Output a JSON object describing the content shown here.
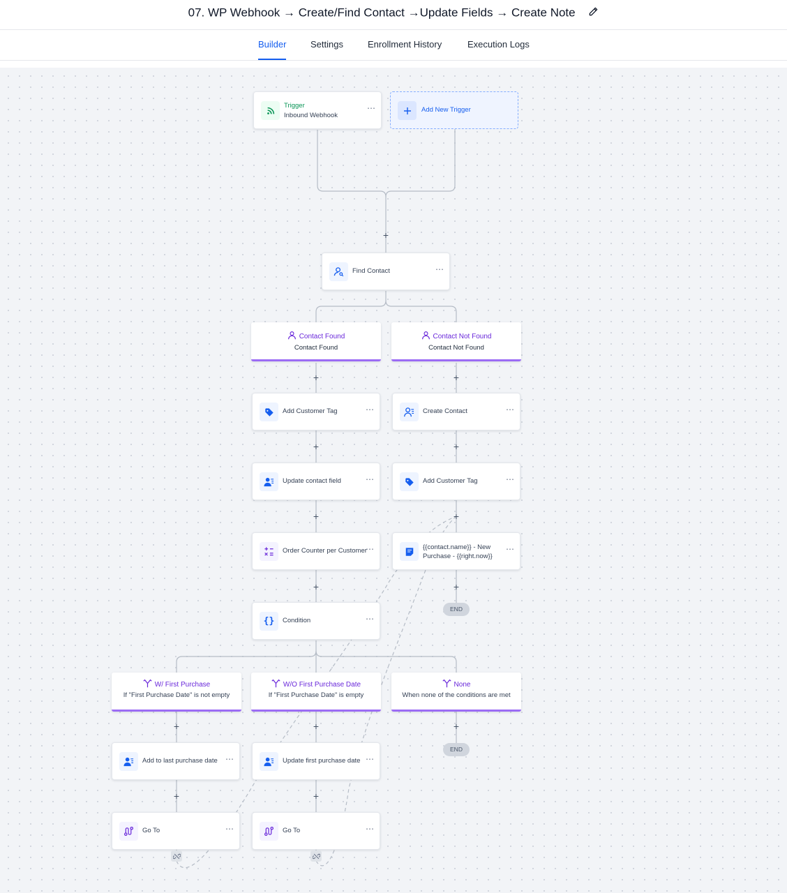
{
  "workflow": {
    "title": "07. WP Webhook → Create/Find Contact →Update Fields → Create Note"
  },
  "tabs": [
    {
      "label": "Builder",
      "active": true
    },
    {
      "label": "Settings",
      "active": false
    },
    {
      "label": "Enrollment History",
      "active": false
    },
    {
      "label": "Execution Logs",
      "active": false
    }
  ],
  "trigger": {
    "title": "Trigger",
    "subtitle": "Inbound Webhook"
  },
  "add_trigger": {
    "label": "Add New Trigger"
  },
  "actions": {
    "find_contact": "Find Contact",
    "add_customer_tag_left": "Add Customer Tag",
    "update_contact_field": "Update contact field",
    "order_counter": "Order Counter per Customer",
    "condition": "Condition",
    "create_contact": "Create Contact",
    "add_customer_tag_right": "Add Customer Tag",
    "create_note": "{{contact.name}} - New Purchase - {{right.now}}",
    "add_last_purchase": "Add to last purchase date",
    "update_first_purchase": "Update first purchase date",
    "goto_left": "Go To",
    "goto_mid": "Go To"
  },
  "branches": {
    "contact_found": {
      "title": "Contact Found",
      "subtitle": "Contact Found"
    },
    "contact_not_found": {
      "title": "Contact Not Found",
      "subtitle": "Contact Not Found"
    },
    "with_first_purchase": {
      "title": "W/ First Purchase",
      "subtitle": "If \"First Purchase Date\" is not empty"
    },
    "without_first_purchase": {
      "title": "W/O First Purchase Date",
      "subtitle": "If \"First Purchase Date\" is empty"
    },
    "none": {
      "title": "None",
      "subtitle": "When none of the conditions are met"
    }
  },
  "end_label": "END",
  "more_glyph": "⋯",
  "plus_glyph": "+",
  "colors": {
    "accent": "#155eef",
    "branch_purple": "#9b6cf5",
    "trigger_green": "#079455"
  }
}
